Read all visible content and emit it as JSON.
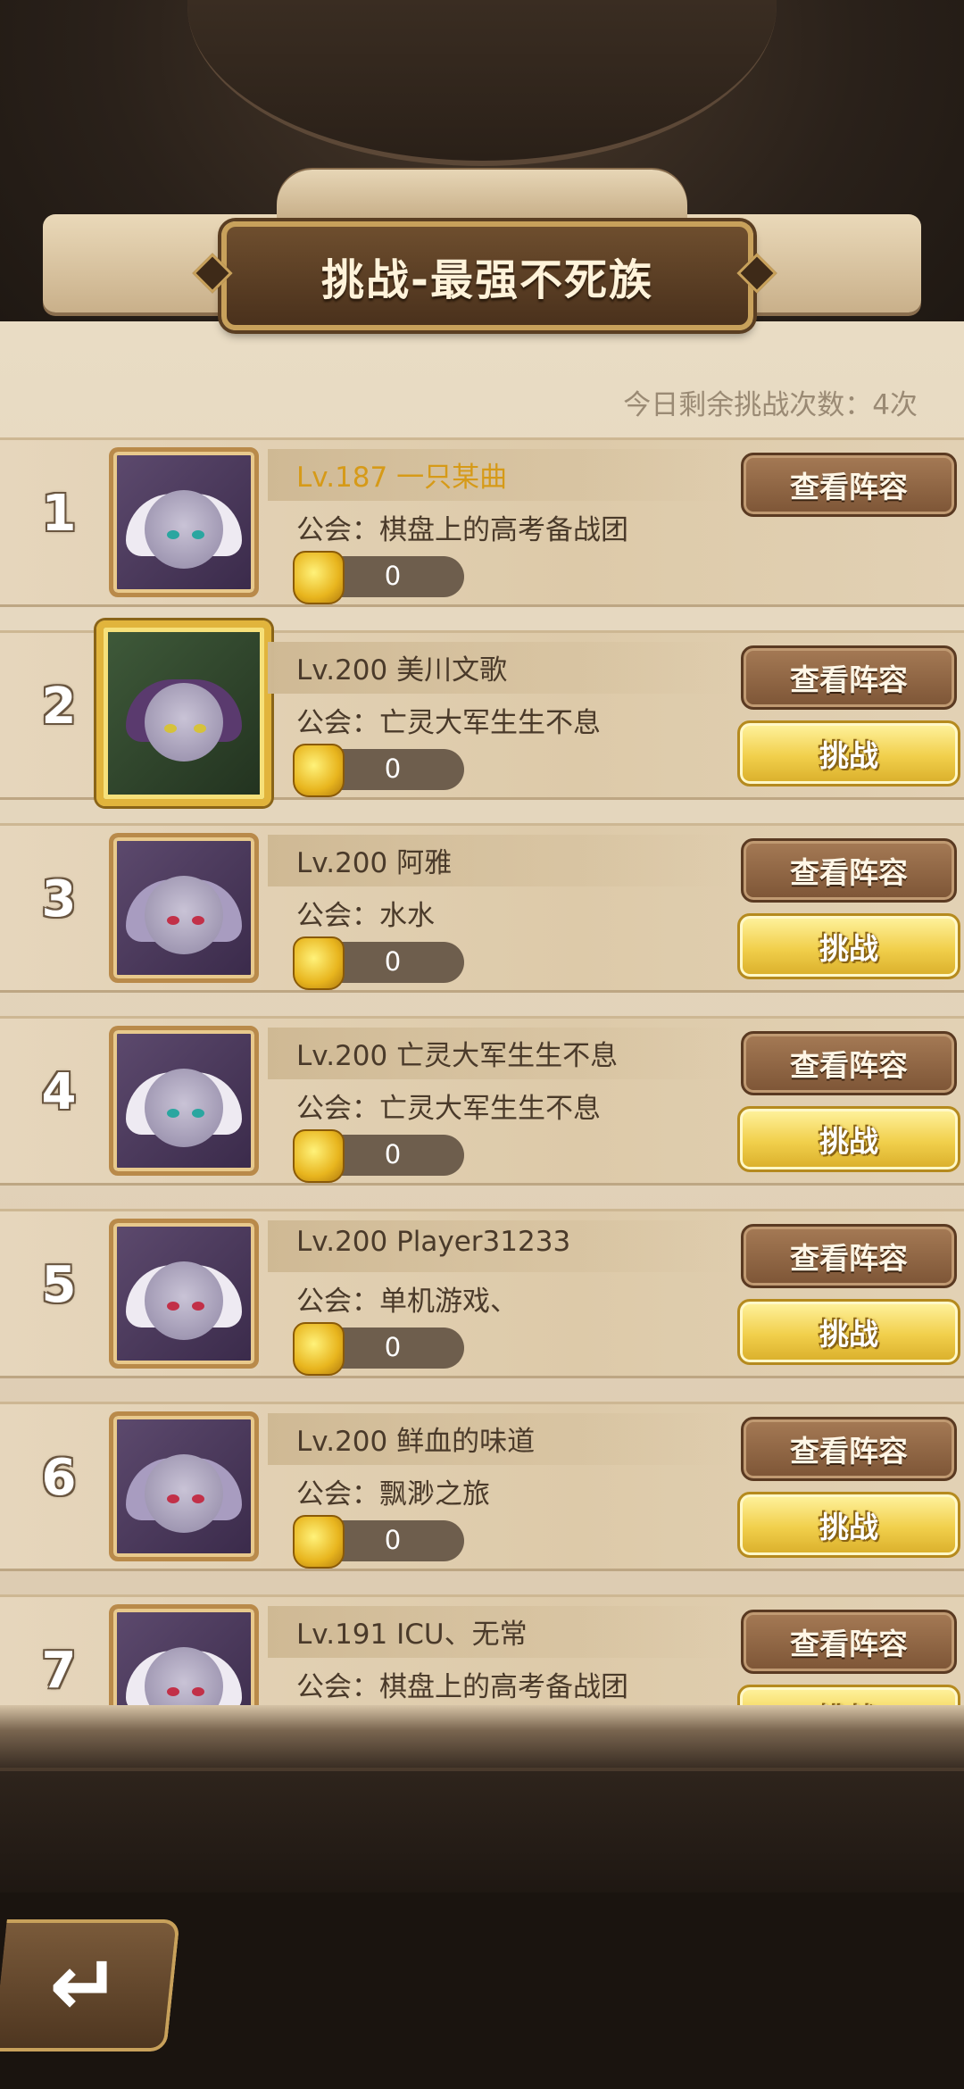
{
  "header": {
    "title": "挑战-最强不死族",
    "remaining": "今日剩余挑战次数：4次"
  },
  "buttons": {
    "view_lineup": "查看阵容",
    "challenge": "挑战"
  },
  "players": [
    {
      "rank": "1",
      "name": "Lv.187 一只某曲",
      "guild": "公会：棋盘上的高考备战团",
      "power": "0"
    },
    {
      "rank": "2",
      "name": "Lv.200 美川文歌",
      "guild": "公会：亡灵大军生生不息",
      "power": "0"
    },
    {
      "rank": "3",
      "name": "Lv.200 阿雅",
      "guild": "公会：水水",
      "power": "0"
    },
    {
      "rank": "4",
      "name": "Lv.200 亡灵大军生生不息",
      "guild": "公会：亡灵大军生生不息",
      "power": "0"
    },
    {
      "rank": "5",
      "name": "Lv.200 Player31233",
      "guild": "公会：单机游戏、",
      "power": "0"
    },
    {
      "rank": "6",
      "name": "Lv.200 鲜血的味道",
      "guild": "公会：飘渺之旅",
      "power": "0"
    },
    {
      "rank": "7",
      "name": "Lv.191 ICU、无常",
      "guild": "公会：棋盘上的高考备战团",
      "power": ""
    }
  ],
  "icons": {
    "power": "fist-icon",
    "back": "back-arrow-icon"
  },
  "colors": {
    "self_name": "#d69a18",
    "challenge_button": "#f1cf4b",
    "view_button": "#8e6444"
  }
}
